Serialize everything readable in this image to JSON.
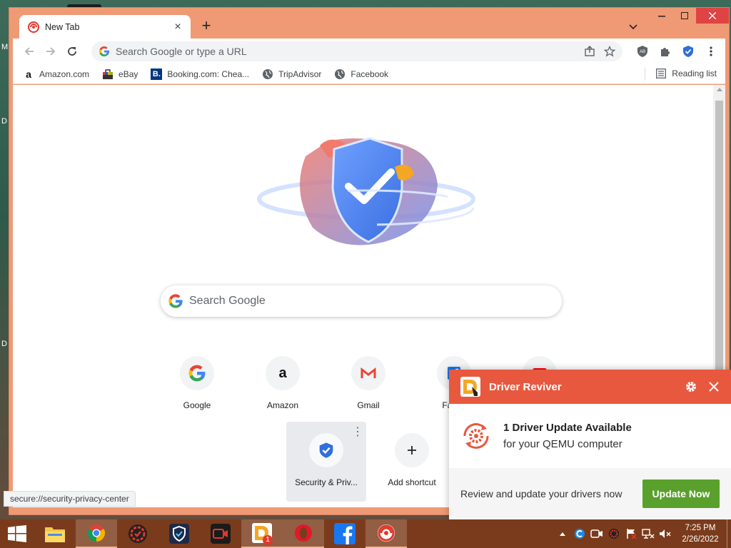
{
  "desktop": {
    "letters": [
      "M",
      "D",
      "D"
    ]
  },
  "browser": {
    "tab": {
      "title": "New Tab",
      "favicon": "security-privacy-icon"
    },
    "omnibox": {
      "placeholder": "Search Google or type a URL"
    },
    "bookmarks": [
      {
        "label": "Amazon.com",
        "icon": "amazon-icon"
      },
      {
        "label": "eBay",
        "icon": "ebay-icon"
      },
      {
        "label": "Booking.com: Chea...",
        "icon": "booking-icon"
      },
      {
        "label": "TripAdvisor",
        "icon": "globe-icon"
      },
      {
        "label": "Facebook",
        "icon": "globe-icon"
      }
    ],
    "reading_list": "Reading list",
    "status_url": "secure://security-privacy-center"
  },
  "ntp": {
    "search_placeholder": "Search Google",
    "shortcuts": [
      {
        "label": "Google",
        "icon": "google-icon"
      },
      {
        "label": "Amazon",
        "icon": "amazon-icon"
      },
      {
        "label": "Gmail",
        "icon": "gmail-icon"
      },
      {
        "label": "Faceb",
        "icon": "facebook-icon"
      },
      {
        "label": "",
        "icon": "youtube-icon"
      },
      {
        "label": "Security & Priv...",
        "icon": "shield-icon"
      },
      {
        "label": "Add shortcut",
        "icon": "plus-icon"
      }
    ]
  },
  "driver_reviver": {
    "title": "Driver Reviver",
    "headline": "1 Driver Update Available",
    "subline": "for your QEMU computer",
    "footer_text": "Review and update your drivers now",
    "button": "Update Now"
  },
  "taskbar": {
    "clock_time": "7:25 PM",
    "clock_date": "2/26/2022",
    "badge": "1"
  },
  "colors": {
    "window_frame": "#ef9a74",
    "popup_header": "#e8583f",
    "update_button": "#5aa02c",
    "taskbar": "#7a3b1c"
  }
}
